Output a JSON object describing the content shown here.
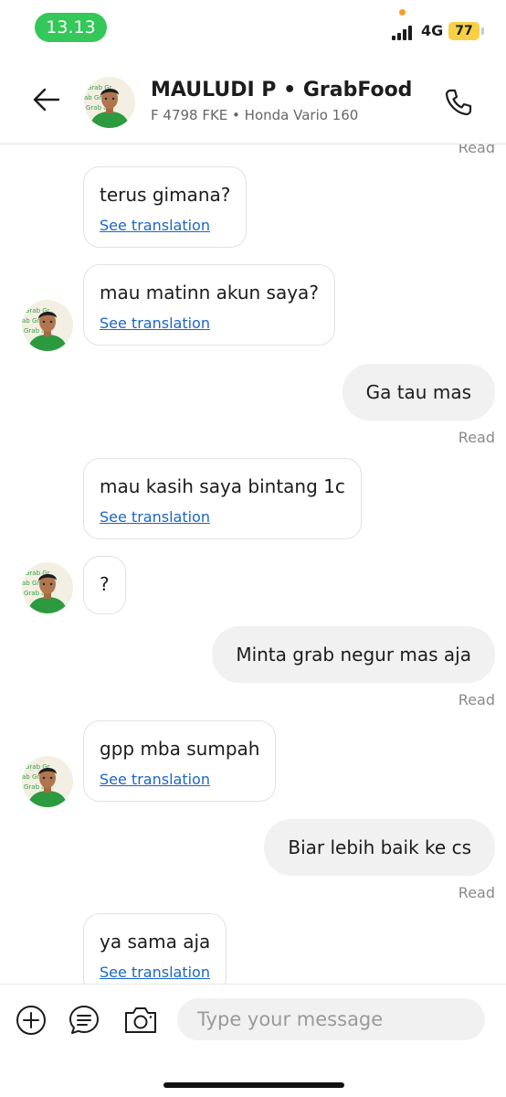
{
  "status_bar": {
    "time": "13.13",
    "network": "4G",
    "battery": "77"
  },
  "header": {
    "driver_name": "MAULUDI P • GrabFood",
    "vehicle_info": "F 4798 FKE • Honda Vario 160",
    "back_icon": "arrow-left-icon",
    "call_icon": "phone-icon"
  },
  "messages": [
    {
      "side": "out",
      "text": "",
      "status": "Read"
    },
    {
      "side": "in",
      "text": "terus gimana?",
      "translation": "See translation"
    },
    {
      "side": "in",
      "text": "mau matinn akun saya?",
      "translation": "See translation"
    },
    {
      "side": "out",
      "text": "Ga tau mas",
      "status": "Read"
    },
    {
      "side": "in",
      "text": "mau kasih saya bintang 1c",
      "translation": "See translation"
    },
    {
      "side": "in",
      "text": "?"
    },
    {
      "side": "out",
      "text": "Minta grab negur mas aja",
      "status": "Read"
    },
    {
      "side": "in",
      "text": "gpp mba sumpah",
      "translation": "See translation"
    },
    {
      "side": "out",
      "text": "Biar lebih baik ke cs",
      "status": "Read"
    },
    {
      "side": "in",
      "text": "ya sama aja",
      "translation": "See translation"
    }
  ],
  "composer": {
    "placeholder": "Type your message",
    "icons": [
      "plus-circle-icon",
      "quick-reply-icon",
      "camera-icon"
    ]
  },
  "colors": {
    "time_pill": "#34c759",
    "battery": "#f7d046",
    "link": "#1a66c9",
    "outgoing_bubble": "#f1f1f1",
    "grab_green": "#2c9a3f"
  }
}
